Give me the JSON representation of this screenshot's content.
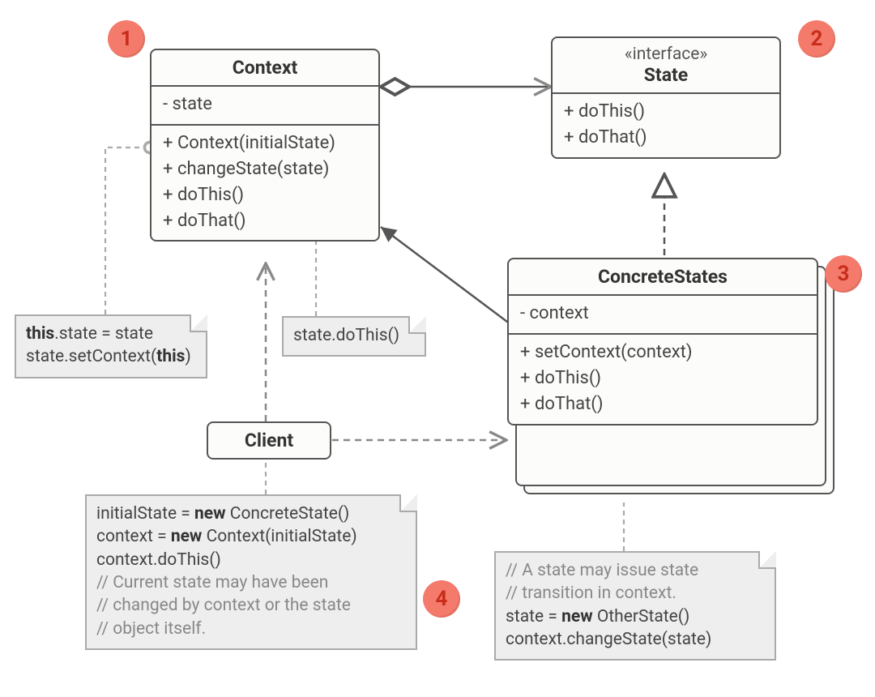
{
  "badges": {
    "b1": "1",
    "b2": "2",
    "b3": "3",
    "b4": "4"
  },
  "context": {
    "title": "Context",
    "attr1": "- state",
    "m1": "+ Context(initialState)",
    "m2": "+ changeState(state)",
    "m3": "+ doThis()",
    "m4": "+ doThat()"
  },
  "state": {
    "stereo": "«interface»",
    "title": "State",
    "m1": "+ doThis()",
    "m2": "+ doThat()"
  },
  "concrete": {
    "title": "ConcreteStates",
    "attr1": "- context",
    "m1": "+ setContext(context)",
    "m2": "+ doThis()",
    "m3": "+ doThat()"
  },
  "client": {
    "title": "Client"
  },
  "note_ctx": {
    "l1a": "this",
    "l1b": ".state = state",
    "l2a": "state.setContext(",
    "l2b": "this",
    "l2c": ")"
  },
  "note_dothis": {
    "l1": "state.doThis()"
  },
  "note_client": {
    "l1a": "initialState = ",
    "l1b": "new",
    "l1c": " ConcreteState()",
    "l2a": "context = ",
    "l2b": "new",
    "l2c": " Context(initialState)",
    "l3": "context.doThis()",
    "c1": "// Current state may have been",
    "c2": "// changed by context or the state",
    "c3": "// object itself."
  },
  "note_concrete": {
    "c1": "// A state may issue state",
    "c2": "// transition in context.",
    "l1a": "state = ",
    "l1b": "new",
    "l1c": " OtherState()",
    "l2": "context.changeState(state)"
  }
}
